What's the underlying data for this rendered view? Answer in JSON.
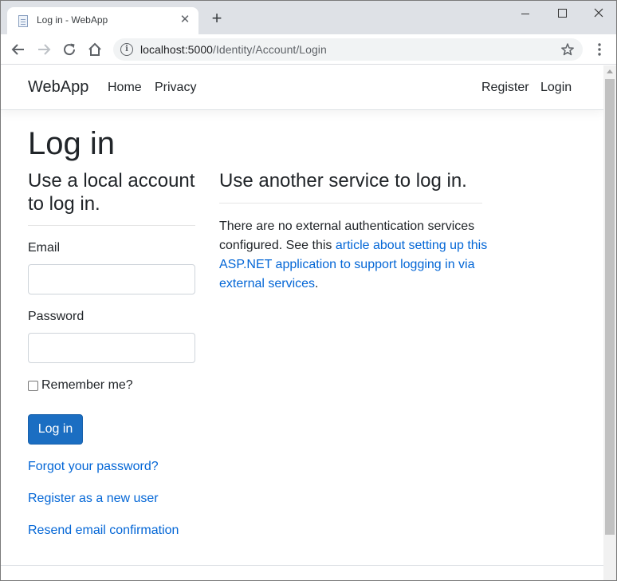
{
  "browser": {
    "tab_title": "Log in - WebApp",
    "url_host": "localhost:5000",
    "url_path": "/Identity/Account/Login"
  },
  "site": {
    "brand": "WebApp",
    "nav_left": [
      "Home",
      "Privacy"
    ],
    "nav_right": [
      "Register",
      "Login"
    ]
  },
  "page": {
    "title": "Log in",
    "local_heading": "Use a local account to log in.",
    "email_label": "Email",
    "email_value": "",
    "password_label": "Password",
    "password_value": "",
    "remember_label": "Remember me?",
    "remember_checked": false,
    "submit_label": "Log in",
    "links": {
      "forgot": "Forgot your password?",
      "register": "Register as a new user",
      "resend": "Resend email confirmation"
    },
    "external_heading": "Use another service to log in.",
    "external_text_1": "There are no external authentication services configured. See this ",
    "external_link": "article about setting up this ASP.NET application to support logging in via external services",
    "external_text_2": "."
  },
  "colors": {
    "primary": "#1b6ec2",
    "link": "#0366d6",
    "tabstrip": "#dee1e6"
  }
}
